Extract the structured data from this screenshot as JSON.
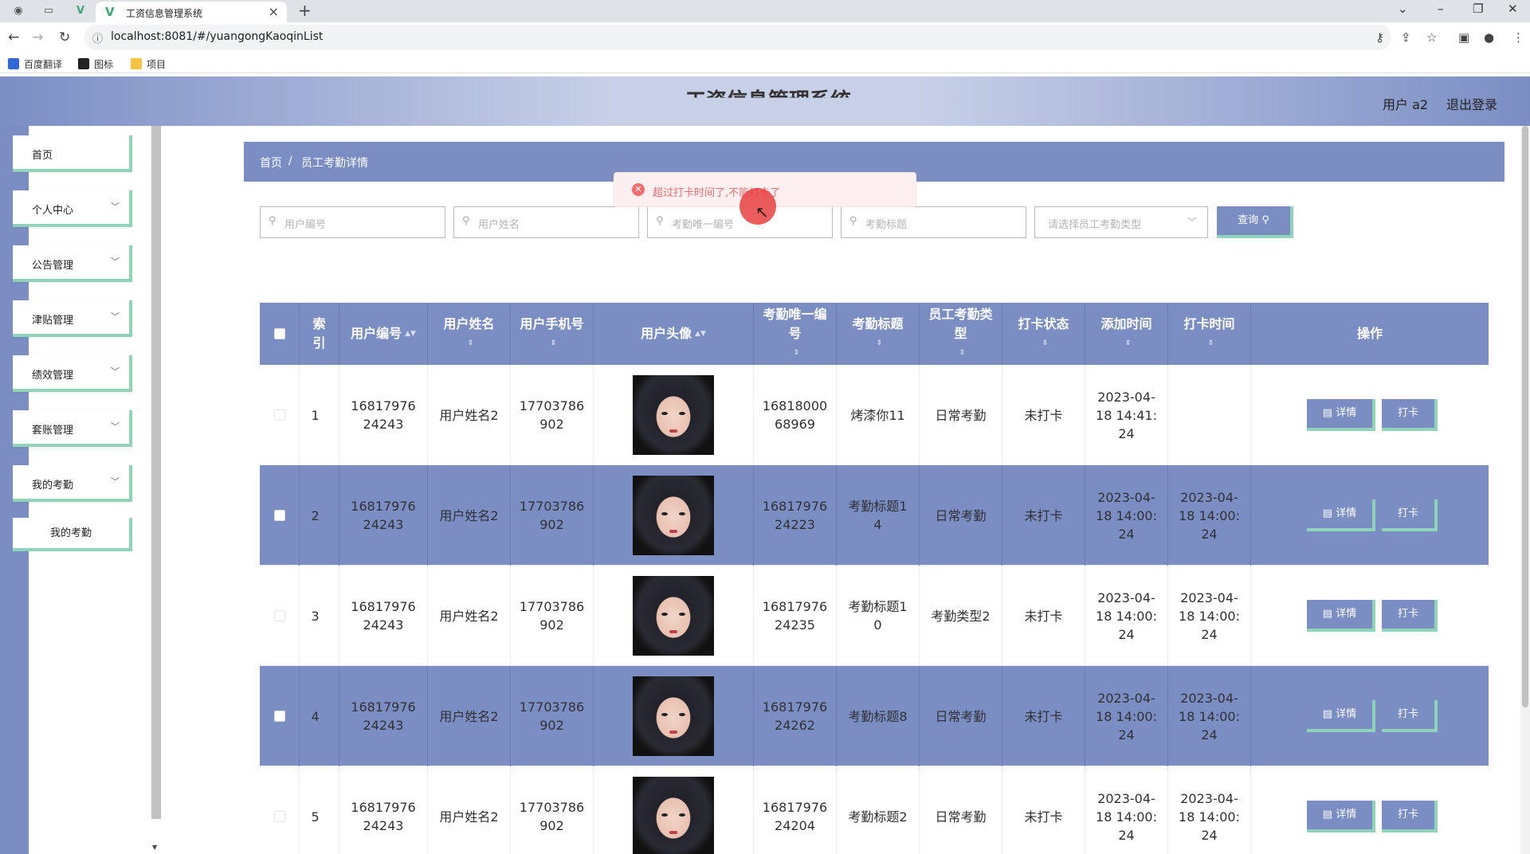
{
  "browser": {
    "tab_title": "工资信息管理系统",
    "url": "localhost:8081/#/yuangongKaoqinList",
    "bookmarks": [
      "百度翻译",
      "图标",
      "项目"
    ]
  },
  "header": {
    "system_title": "工资信息管理系统",
    "user_label": "用户 a2",
    "logout_label": "退出登录"
  },
  "sidebar": {
    "items": [
      {
        "label": "首页"
      },
      {
        "label": "个人中心"
      },
      {
        "label": "公告管理"
      },
      {
        "label": "津贴管理"
      },
      {
        "label": "绩效管理"
      },
      {
        "label": "套账管理"
      },
      {
        "label": "我的考勤"
      }
    ],
    "sub_item": "我的考勤"
  },
  "breadcrumb": {
    "home": "首页",
    "sep": "/",
    "current": "员工考勤详情"
  },
  "search": {
    "user_no_placeholder": "用户编号",
    "user_name_placeholder": "用户姓名",
    "kaoqin_no_placeholder": "考勤唯一编号",
    "kaoqin_title_placeholder": "考勤标题",
    "type_placeholder": "请选择员工考勤类型",
    "query_label": "查询"
  },
  "table": {
    "headers": {
      "index": "索引",
      "user_no": "用户编号",
      "user_name": "用户姓名",
      "phone": "用户手机号",
      "avatar": "用户头像",
      "kaoqin_no": "考勤唯一编号",
      "title": "考勤标题",
      "type": "员工考勤类型",
      "status": "打卡状态",
      "add_time": "添加时间",
      "punch_time": "打卡时间",
      "actions": "操作"
    },
    "detail_label": "详情",
    "punch_label": "打卡",
    "rows": [
      {
        "index": "1",
        "user_no": "1681797624243",
        "user_name": "用户姓名2",
        "phone": "17703786902",
        "kaoqin_no": "1681800068969",
        "title": "烤漆你11",
        "type": "日常考勤",
        "status": "未打卡",
        "add_time": "2023-04-18 14:41:24",
        "punch_time": ""
      },
      {
        "index": "2",
        "user_no": "1681797624243",
        "user_name": "用户姓名2",
        "phone": "17703786902",
        "kaoqin_no": "1681797624223",
        "title": "考勤标题14",
        "type": "日常考勤",
        "status": "未打卡",
        "add_time": "2023-04-18 14:00:24",
        "punch_time": "2023-04-18 14:00:24"
      },
      {
        "index": "3",
        "user_no": "1681797624243",
        "user_name": "用户姓名2",
        "phone": "17703786902",
        "kaoqin_no": "1681797624235",
        "title": "考勤标题10",
        "type": "考勤类型2",
        "status": "未打卡",
        "add_time": "2023-04-18 14:00:24",
        "punch_time": "2023-04-18 14:00:24"
      },
      {
        "index": "4",
        "user_no": "1681797624243",
        "user_name": "用户姓名2",
        "phone": "17703786902",
        "kaoqin_no": "1681797624262",
        "title": "考勤标题8",
        "type": "日常考勤",
        "status": "未打卡",
        "add_time": "2023-04-18 14:00:24",
        "punch_time": "2023-04-18 14:00:24"
      },
      {
        "index": "5",
        "user_no": "1681797624243",
        "user_name": "用户姓名2",
        "phone": "17703786902",
        "kaoqin_no": "1681797624204",
        "title": "考勤标题2",
        "type": "日常考勤",
        "status": "未打卡",
        "add_time": "2023-04-18 14:00:24",
        "punch_time": "2023-04-18 14:00:24"
      }
    ]
  },
  "toast": {
    "message": "超过打卡时间了,不能打卡了"
  },
  "colors": {
    "primary": "#7b8ec4",
    "accent": "#8fd3b8",
    "error": "#f56c6c"
  }
}
